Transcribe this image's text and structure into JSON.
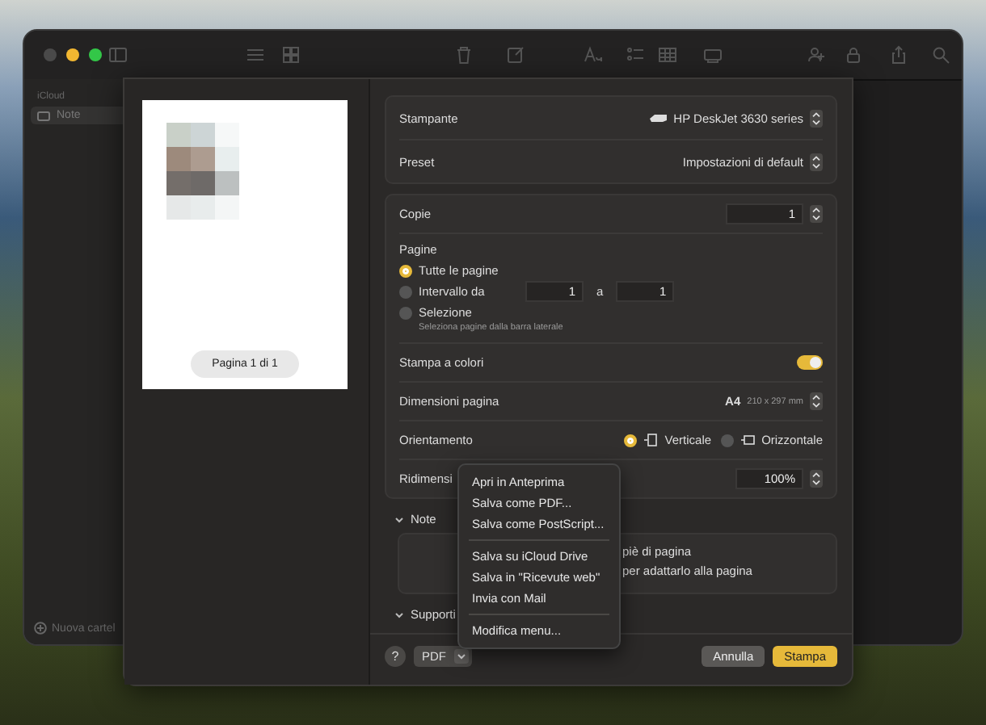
{
  "window": {
    "sidebar": {
      "section": "iCloud",
      "items": [
        {
          "label": "Note",
          "selected": true
        }
      ],
      "new_folder": "Nuova cartel"
    }
  },
  "print_dialog": {
    "preview": {
      "page_indicator": "Pagina 1 di 1"
    },
    "printer": {
      "label": "Stampante",
      "value": "HP DeskJet 3630 series"
    },
    "preset": {
      "label": "Preset",
      "value": "Impostazioni di default"
    },
    "copies": {
      "label": "Copie",
      "value": "1"
    },
    "pages": {
      "label": "Pagine",
      "options": [
        {
          "label": "Tutte le pagine",
          "selected": true
        },
        {
          "label": "Intervallo da",
          "selected": false,
          "from": "1",
          "to_label": "a",
          "to": "1"
        },
        {
          "label": "Selezione",
          "selected": false,
          "hint": "Seleziona pagine dalla barra laterale"
        }
      ]
    },
    "color_print": {
      "label": "Stampa a colori",
      "on": true
    },
    "paper_size": {
      "label": "Dimensioni pagina",
      "value": "A4",
      "detail": "210 x 297 mm"
    },
    "orientation": {
      "label": "Orientamento",
      "options": [
        {
          "label": "Verticale",
          "selected": true
        },
        {
          "label": "Orizzontale",
          "selected": false
        }
      ]
    },
    "scaling": {
      "label": "Ridimensi",
      "value": "100%"
    },
    "sections": [
      {
        "title": "Note",
        "expanded": true,
        "lines": [
          "piè di pagina",
          "per adattarlo alla pagina"
        ]
      },
      {
        "title": "Supporti",
        "expanded": true
      }
    ],
    "help": "?",
    "pdf_button": "PDF",
    "cancel": "Annulla",
    "print": "Stampa"
  },
  "pdf_menu": {
    "groups": [
      [
        "Apri in Anteprima",
        "Salva come PDF...",
        "Salva come PostScript..."
      ],
      [
        "Salva su iCloud Drive",
        "Salva in \"Ricevute web\"",
        "Invia con Mail"
      ],
      [
        "Modifica menu..."
      ]
    ]
  }
}
